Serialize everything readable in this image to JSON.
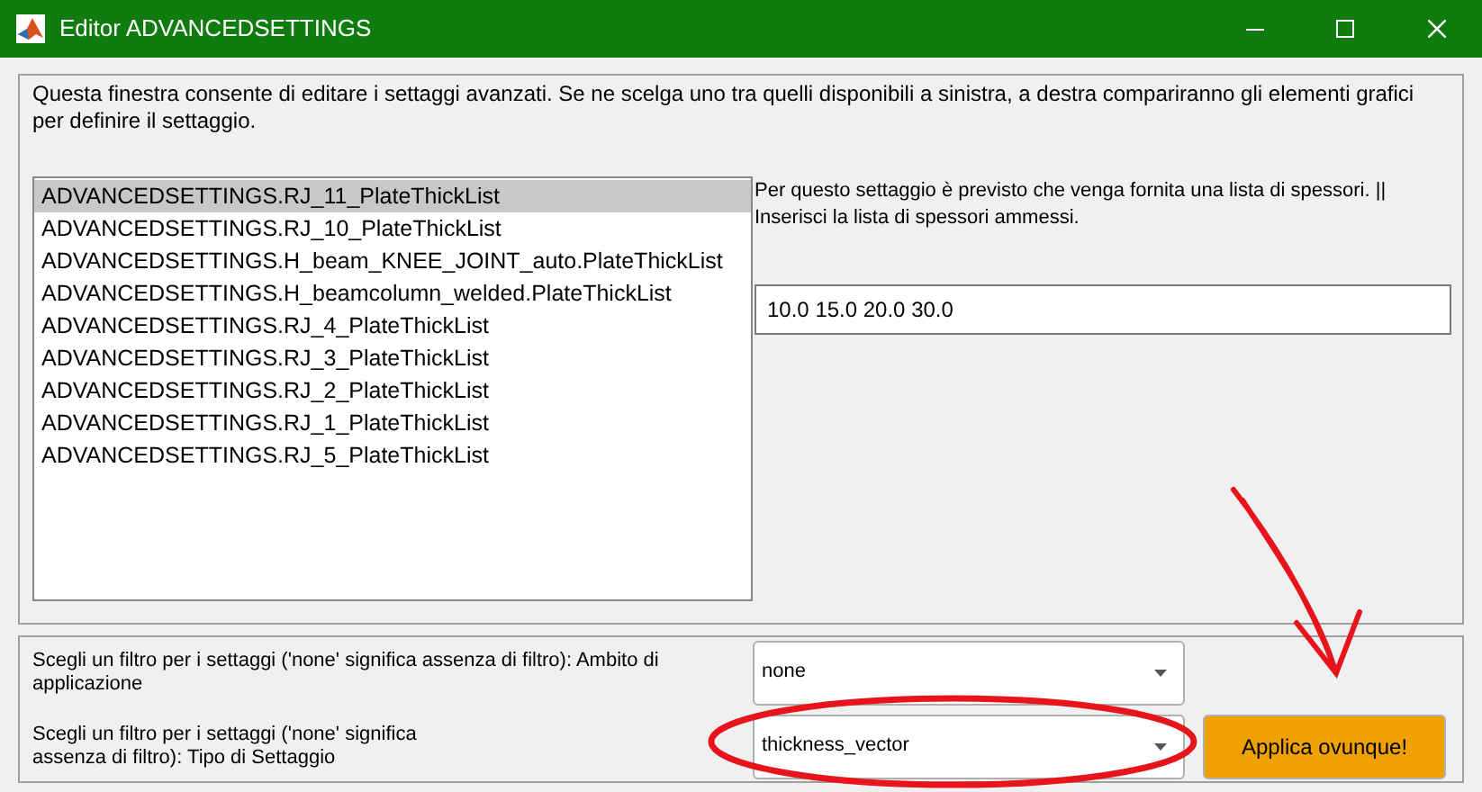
{
  "window": {
    "title": "Editor ADVANCEDSETTINGS"
  },
  "description": "Questa finestra consente di editare i settaggi avanzati. Se ne scelga uno tra quelli disponibili a sinistra, a destra compariranno gli elementi grafici per definire il settaggio.",
  "settings_list": [
    {
      "label": "ADVANCEDSETTINGS.RJ_11_PlateThickList",
      "selected": true
    },
    {
      "label": "ADVANCEDSETTINGS.RJ_10_PlateThickList",
      "selected": false
    },
    {
      "label": "ADVANCEDSETTINGS.H_beam_KNEE_JOINT_auto.PlateThickList",
      "selected": false
    },
    {
      "label": "ADVANCEDSETTINGS.H_beamcolumn_welded.PlateThickList",
      "selected": false
    },
    {
      "label": "ADVANCEDSETTINGS.RJ_4_PlateThickList",
      "selected": false
    },
    {
      "label": "ADVANCEDSETTINGS.RJ_3_PlateThickList",
      "selected": false
    },
    {
      "label": "ADVANCEDSETTINGS.RJ_2_PlateThickList",
      "selected": false
    },
    {
      "label": "ADVANCEDSETTINGS.RJ_1_PlateThickList",
      "selected": false
    },
    {
      "label": "ADVANCEDSETTINGS.RJ_5_PlateThickList",
      "selected": false
    }
  ],
  "setting_info": "Per questo settaggio è previsto che venga fornita una lista di spessori.  || Inserisci la lista di spessori ammessi.",
  "value_field": {
    "value": "10.0 15.0 20.0 30.0"
  },
  "filters": [
    {
      "label": "Scegli un filtro per i settaggi ('none' significa assenza di filtro): Ambito di applicazione",
      "value": "none"
    },
    {
      "label": "Scegli un filtro per i settaggi ('none' significa assenza di filtro): Tipo di Settaggio",
      "value": "thickness_vector"
    }
  ],
  "apply_button": "Applica ovunque!"
}
